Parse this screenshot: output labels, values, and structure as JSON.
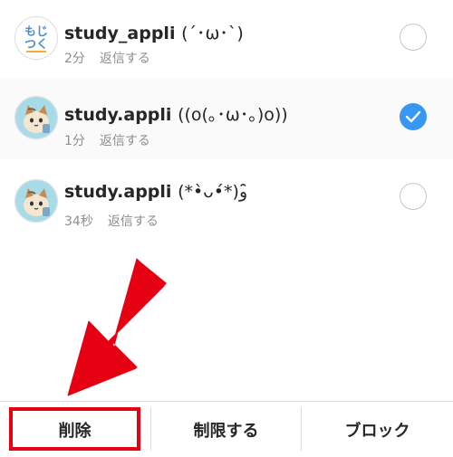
{
  "comments": [
    {
      "username": "study_appli",
      "text": "(´･ω･`)",
      "time": "2分",
      "reply_label": "返信する",
      "checked": false,
      "avatar": "mojitsuku-logo"
    },
    {
      "username": "study.appli",
      "text": "((o(｡･ω･｡)o))",
      "time": "1分",
      "reply_label": "返信する",
      "checked": true,
      "avatar": "cat-avatar"
    },
    {
      "username": "study.appli",
      "text": "(*•̀ᴗ•́*)و ̑̑",
      "time": "34秒",
      "reply_label": "返信する",
      "checked": false,
      "avatar": "cat-avatar"
    }
  ],
  "toolbar": {
    "delete_label": "削除",
    "restrict_label": "制限する",
    "block_label": "ブロック"
  },
  "avatar_logo_text": {
    "line1": "もじ",
    "line2": "つく"
  },
  "colors": {
    "accent": "#3897f0",
    "annotation_red": "#e50012",
    "meta": "#8e8e8e"
  }
}
